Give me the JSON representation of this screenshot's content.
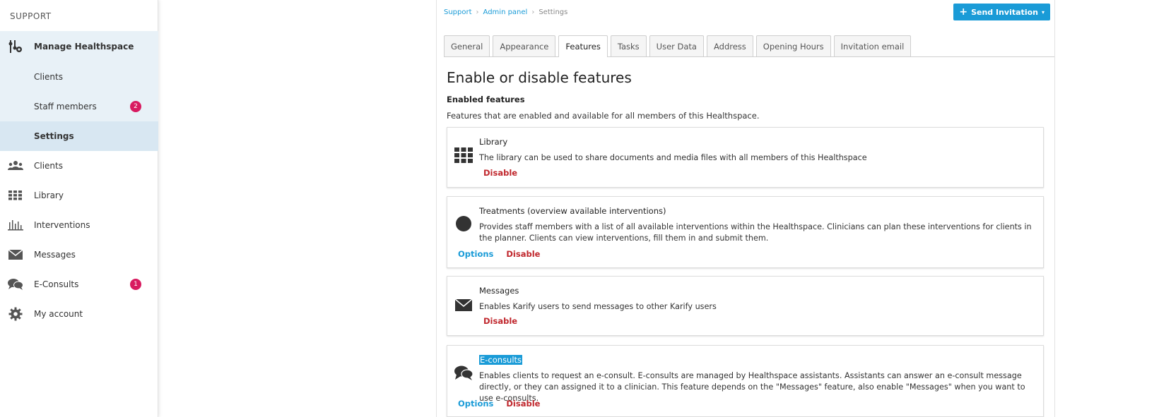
{
  "sidebar": {
    "header": "SUPPORT",
    "items": [
      {
        "label": "Manage Healthspace",
        "icon": "manage-icon"
      },
      {
        "label": "Clients"
      },
      {
        "label": "Staff members",
        "badge": "2"
      },
      {
        "label": "Settings"
      },
      {
        "label": "Clients",
        "icon": "clients-icon"
      },
      {
        "label": "Library",
        "icon": "library-icon"
      },
      {
        "label": "Interventions",
        "icon": "interventions-icon"
      },
      {
        "label": "Messages",
        "icon": "envelope-icon"
      },
      {
        "label": "E-Consults",
        "icon": "chat-icon",
        "badge": "1"
      },
      {
        "label": "My account",
        "icon": "gear-icon"
      }
    ]
  },
  "breadcrumb": {
    "items": [
      "Support",
      "Admin panel",
      "Settings"
    ]
  },
  "header": {
    "send_button": "Send Invitation"
  },
  "tabs": [
    "General",
    "Appearance",
    "Features",
    "Tasks",
    "User Data",
    "Address",
    "Opening Hours",
    "Invitation email"
  ],
  "main": {
    "title": "Enable or disable features",
    "section_title": "Enabled features",
    "section_desc": "Features that are enabled and available for all members of this Healthspace."
  },
  "features": [
    {
      "title": "Library",
      "desc": "The library can be used to share documents and media files with all members of this Healthspace",
      "disable": "Disable"
    },
    {
      "title": "Treatments (overview available interventions)",
      "desc": "Provides staff members with a list of all available interventions within the Healthspace. Clinicians can plan these interventions for clients in the planner. Clients can view interventions, fill them in and submit them.",
      "options": "Options",
      "disable": "Disable"
    },
    {
      "title": "Messages",
      "desc": "Enables Karify users to send messages to other Karify users",
      "disable": "Disable"
    },
    {
      "title": "E-consults",
      "desc": "Enables clients to request an e-consult. E-consults are managed by Healthspace assistants. Assistants can answer an e-consult message directly, or they can assigned it to a clinician. This feature depends on the \"Messages\" feature, also enable \"Messages\" when you want to use e-consults.",
      "options": "Options",
      "disable": "Disable"
    }
  ],
  "colors": {
    "accent": "#1a9bd7",
    "danger": "#c0272d",
    "badge": "#d81b60"
  }
}
